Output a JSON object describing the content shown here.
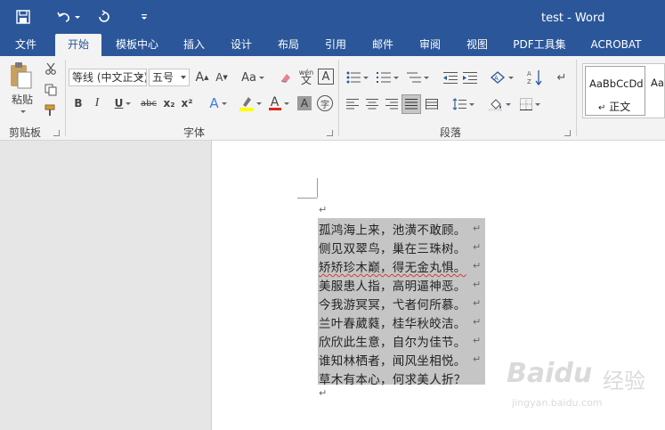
{
  "window": {
    "title": "test - Word"
  },
  "quick_access": [
    "save-icon",
    "undo-icon",
    "redo-icon",
    "customize-icon"
  ],
  "tabs": [
    {
      "label": "文件"
    },
    {
      "label": "开始"
    },
    {
      "label": "模板中心"
    },
    {
      "label": "插入"
    },
    {
      "label": "设计"
    },
    {
      "label": "布局"
    },
    {
      "label": "引用"
    },
    {
      "label": "邮件"
    },
    {
      "label": "审阅"
    },
    {
      "label": "视图"
    },
    {
      "label": "PDF工具集"
    },
    {
      "label": "ACROBAT"
    }
  ],
  "active_tab": "开始",
  "ribbon": {
    "clipboard": {
      "paste_label": "粘贴",
      "group_label": "剪贴板"
    },
    "font": {
      "font_name": "等线 (中文正文)",
      "font_size": "五号",
      "grow": "A",
      "shrink": "A",
      "change_case": "Aa",
      "phonetic": "wén",
      "border_char": "A",
      "bold": "B",
      "italic": "I",
      "underline": "U",
      "strike": "abc",
      "subscript": "x₂",
      "superscript": "x²",
      "effects": "A",
      "font_color": "A",
      "shading": "A",
      "enclose": "字",
      "group_label": "字体"
    },
    "paragraph": {
      "group_label": "段落"
    },
    "styles": {
      "normal_preview": "AaBbCcDd",
      "normal_label": "正文",
      "next_preview": "Aa"
    }
  },
  "colors": {
    "title_bar": "#2b579a",
    "ribbon_bg": "#f3f3f3",
    "highlight": "#ffff00",
    "font_color": "#e0261f",
    "selection": "#c5c5c5"
  },
  "document": {
    "lines": [
      "孤鸿海上来，池潢不敢顾。",
      "侧见双翠鸟，巢在三珠树。",
      "矫矫珍木巅，得无金丸惧。",
      "美服患人指，高明逼神恶。",
      "今我游冥冥，弋者何所慕。",
      "兰叶春葳蕤，桂华秋皎洁。",
      "欣欣此生意，自尔为佳节。",
      "谁知林栖者，闻风坐相悦。",
      "草木有本心，何求美人折？"
    ],
    "paragraph_mark": "↵"
  },
  "watermark": {
    "brand": "Baidu",
    "brand_cn": "经验",
    "url": "jingyan.baidu.com"
  }
}
